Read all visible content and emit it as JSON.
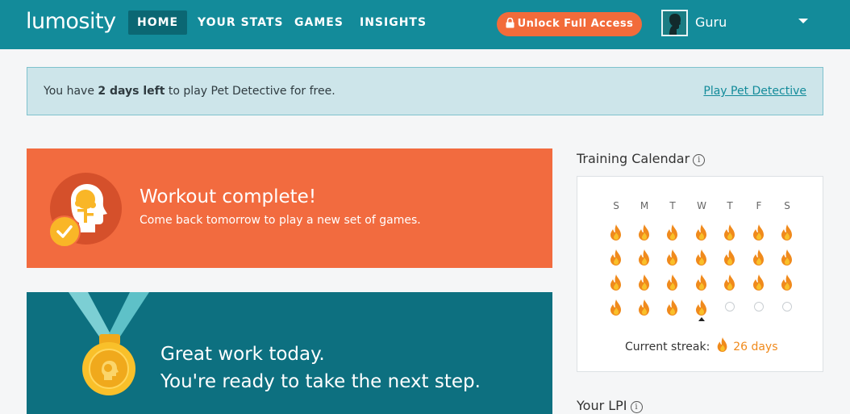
{
  "header": {
    "logo": "lumosity",
    "nav": [
      "HOME",
      "YOUR STATS",
      "GAMES",
      "INSIGHTS"
    ],
    "unlock_label": "Unlock Full Access",
    "username": "Guru"
  },
  "banner": {
    "prefix": "You have ",
    "highlight": "2 days left",
    "suffix": " to play Pet Detective for free.",
    "link": "Play Pet Detective"
  },
  "workout": {
    "title": "Workout complete!",
    "subtitle": "Come back tomorrow to play a new set of games."
  },
  "great_work": {
    "line1": "Great work today.",
    "line2": "You're ready to take the next step."
  },
  "calendar": {
    "title": "Training Calendar",
    "info": "i",
    "days": [
      "S",
      "M",
      "T",
      "W",
      "T",
      "F",
      "S"
    ],
    "weeks": [
      [
        1,
        1,
        1,
        1,
        1,
        1,
        1
      ],
      [
        1,
        1,
        1,
        1,
        1,
        1,
        1
      ],
      [
        1,
        1,
        1,
        1,
        1,
        1,
        1
      ],
      [
        1,
        1,
        1,
        1,
        0,
        0,
        0
      ]
    ],
    "streak_label": "Current streak:",
    "streak_value": "26 days"
  },
  "lpi": {
    "title": "Your LPI",
    "info": "i"
  },
  "colors": {
    "header": "#138b9a",
    "accent_orange": "#f26b3f",
    "teal_dark": "#0d7080",
    "flame": "#f08a1c"
  }
}
